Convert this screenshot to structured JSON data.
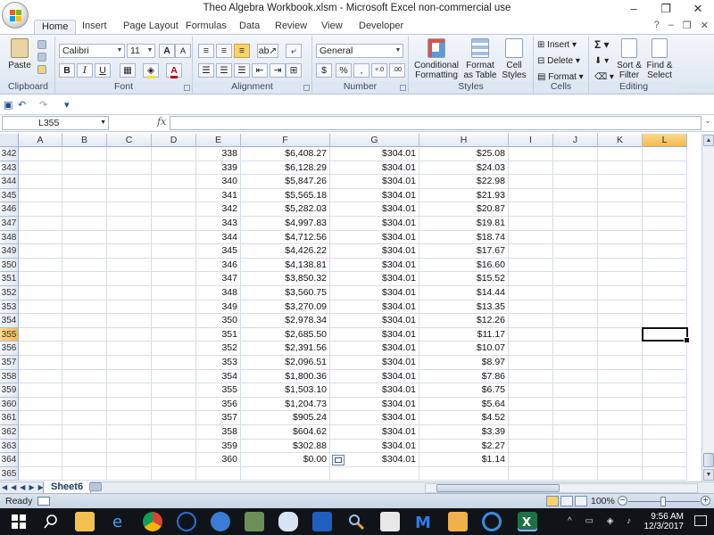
{
  "window": {
    "title": "Theo Algebra Workbook.xlsm - Microsoft Excel non-commercial use",
    "min": "–",
    "max": "❐",
    "close": "✕"
  },
  "tabs": [
    "Home",
    "Insert",
    "Page Layout",
    "Formulas",
    "Data",
    "Review",
    "View",
    "Developer"
  ],
  "tab_help": "?",
  "ribbon": {
    "clipboard": {
      "label": "Clipboard",
      "paste": "Paste"
    },
    "font": {
      "label": "Font",
      "name": "Calibri",
      "size": "11",
      "bold": "B",
      "italic": "I",
      "underline": "U",
      "grow": "A",
      "shrink": "A"
    },
    "alignment": {
      "label": "Alignment"
    },
    "number": {
      "label": "Number",
      "format": "General",
      "currency": "$",
      "percent": "%",
      "comma": ",",
      "inc_dec": "←.0 .00",
      "dec_dec": ".00 →.0"
    },
    "styles": {
      "label": "Styles",
      "conditional": "Conditional Formatting",
      "format_table": "Format as Table",
      "cell_styles": "Cell Styles"
    },
    "cells": {
      "label": "Cells",
      "insert": "Insert",
      "delete": "Delete",
      "format": "Format"
    },
    "editing": {
      "label": "Editing",
      "sigma": "Σ",
      "sort": "Sort & Filter",
      "find": "Find & Select"
    }
  },
  "qat": {
    "undo": "↶",
    "redo": "↷",
    "customize": "▾"
  },
  "formula_bar": {
    "name_box": "L355",
    "fx": "fx",
    "value": ""
  },
  "columns": [
    "A",
    "B",
    "C",
    "D",
    "E",
    "F",
    "G",
    "H",
    "I",
    "J",
    "K",
    "L"
  ],
  "active_column": "L",
  "active_row": "355",
  "rows": [
    {
      "r": "342",
      "e": "338",
      "f": "$6,408.27",
      "g": "$304.01",
      "h": "$25.08"
    },
    {
      "r": "343",
      "e": "339",
      "f": "$6,128.29",
      "g": "$304.01",
      "h": "$24.03"
    },
    {
      "r": "344",
      "e": "340",
      "f": "$5,847.26",
      "g": "$304.01",
      "h": "$22.98"
    },
    {
      "r": "345",
      "e": "341",
      "f": "$5,565.18",
      "g": "$304.01",
      "h": "$21.93"
    },
    {
      "r": "346",
      "e": "342",
      "f": "$5,282.03",
      "g": "$304.01",
      "h": "$20.87"
    },
    {
      "r": "347",
      "e": "343",
      "f": "$4,997.83",
      "g": "$304.01",
      "h": "$19.81"
    },
    {
      "r": "348",
      "e": "344",
      "f": "$4,712.56",
      "g": "$304.01",
      "h": "$18.74"
    },
    {
      "r": "349",
      "e": "345",
      "f": "$4,426.22",
      "g": "$304.01",
      "h": "$17.67"
    },
    {
      "r": "350",
      "e": "346",
      "f": "$4,138.81",
      "g": "$304.01",
      "h": "$16.60"
    },
    {
      "r": "351",
      "e": "347",
      "f": "$3,850.32",
      "g": "$304.01",
      "h": "$15.52"
    },
    {
      "r": "352",
      "e": "348",
      "f": "$3,560.75",
      "g": "$304.01",
      "h": "$14.44"
    },
    {
      "r": "353",
      "e": "349",
      "f": "$3,270.09",
      "g": "$304.01",
      "h": "$13.35"
    },
    {
      "r": "354",
      "e": "350",
      "f": "$2,978.34",
      "g": "$304.01",
      "h": "$12.26"
    },
    {
      "r": "355",
      "e": "351",
      "f": "$2,685.50",
      "g": "$304.01",
      "h": "$11.17"
    },
    {
      "r": "356",
      "e": "352",
      "f": "$2,391.56",
      "g": "$304.01",
      "h": "$10.07"
    },
    {
      "r": "357",
      "e": "353",
      "f": "$2,096.51",
      "g": "$304.01",
      "h": "$8.97"
    },
    {
      "r": "358",
      "e": "354",
      "f": "$1,800.36",
      "g": "$304.01",
      "h": "$7.86"
    },
    {
      "r": "359",
      "e": "355",
      "f": "$1,503.10",
      "g": "$304.01",
      "h": "$6.75"
    },
    {
      "r": "360",
      "e": "356",
      "f": "$1,204.73",
      "g": "$304.01",
      "h": "$5.64"
    },
    {
      "r": "361",
      "e": "357",
      "f": "$905.24",
      "g": "$304.01",
      "h": "$4.52"
    },
    {
      "r": "362",
      "e": "358",
      "f": "$604.62",
      "g": "$304.01",
      "h": "$3.39"
    },
    {
      "r": "363",
      "e": "359",
      "f": "$302.88",
      "g": "$304.01",
      "h": "$2.27"
    },
    {
      "r": "364",
      "e": "360",
      "f": "$0.00",
      "g": "$304.01",
      "h": "$1.14"
    },
    {
      "r": "365",
      "e": "",
      "f": "",
      "g": "",
      "h": ""
    }
  ],
  "sheet_tab": "Sheet6",
  "status": {
    "ready": "Ready",
    "zoom": "100%",
    "minus": "−",
    "plus": "+"
  },
  "taskbar": {
    "time": "9:56 AM",
    "date": "12/3/2017"
  }
}
